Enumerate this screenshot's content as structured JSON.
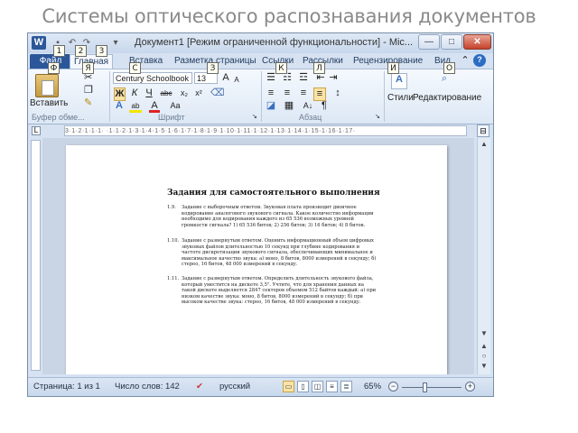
{
  "slide_title": "Системы оптического распознавания документов",
  "window": {
    "title": "Документ1 [Режим ограниченной функциональности] - Mic...",
    "app_icon": "W",
    "qat_icons": [
      "save-icon",
      "undo-icon",
      "redo-icon",
      "customize-qat-icon"
    ],
    "controls": {
      "minimize": "—",
      "maximize": "□",
      "close": "✕"
    }
  },
  "keytips": {
    "qat": [
      "1",
      "2",
      "3"
    ],
    "tabs": [
      "Ф",
      "Я",
      "С",
      "З",
      "К",
      "Л",
      "И",
      "О"
    ]
  },
  "tabs": [
    {
      "label": "Файл"
    },
    {
      "label": "Главная"
    },
    {
      "label": "Вставка"
    },
    {
      "label": "Разметка страницы"
    },
    {
      "label": "Ссылки"
    },
    {
      "label": "Рассылки"
    },
    {
      "label": "Рецензирование"
    },
    {
      "label": "Вид"
    }
  ],
  "ribbon": {
    "clipboard": {
      "paste_label": "Вставить",
      "group_label": "Буфер обме..."
    },
    "font": {
      "font_name": "Century Schoolbook",
      "font_size": "13",
      "bold": "Ж",
      "italic": "К",
      "underline": "Ч",
      "strike": "abc",
      "subscript": "x₂",
      "superscript": "x²",
      "grow": "A",
      "shrink": "A",
      "case": "Aa",
      "group_label": "Шрифт"
    },
    "paragraph": {
      "group_label": "Абзац"
    },
    "styles": {
      "label": "Стили"
    },
    "editing": {
      "label": "Редактирование"
    }
  },
  "ruler_text": "3·1·2·1·1·1·  ·1·1·2·1·3·1·4·1·5·1·6·1·7·1·8·1·9·1·10·1·11·1·12·1·13·1·14·1·15·1·16·1·17·",
  "document": {
    "heading": "Задания для самостоятельного выполнения",
    "tasks": [
      {
        "num": "1.9.",
        "text": "Задание с выборочным ответом. Звуковая плата производит двоичное кодирование аналогового звукового сигнала. Какое количество информации необходимо для кодирования каждого из 65 536 возможных уровней громкости сигнала? 1) 65 536 битов; 2) 256 битов; 3) 16 битов; 4) 8 битов."
      },
      {
        "num": "1.10.",
        "text": "Задание с развернутым ответом. Оценить информационный объем цифровых звуковых файлов длительностью 10 секунд при глубине кодирования и частоте дискретизации звукового сигнала, обеспечивающих минимальное и максимальное качество звука: а) моно, 8 битов, 8000 измерений в секунду; б) стерео, 16 битов, 48 000 измерений в секунду."
      },
      {
        "num": "1.11.",
        "text": "Задание с развернутым ответом. Определить длительность звукового файла, который уместится на дискете 3,5\". Учтите, что для хранения данных на такой дискете выделяется 2847 секторов объемом 512 байтов каждый: а) при низком качестве звука: моно, 8 битов, 8000 измерений в секунду; б) при высоком качестве звука: стерео, 16 битов, 48 000 измерений в секунду."
      }
    ]
  },
  "status_bar": {
    "page": "Страница: 1 из 1",
    "words": "Число слов: 142",
    "language": "русский",
    "zoom": "65%",
    "zoom_fraction": 0.38
  }
}
